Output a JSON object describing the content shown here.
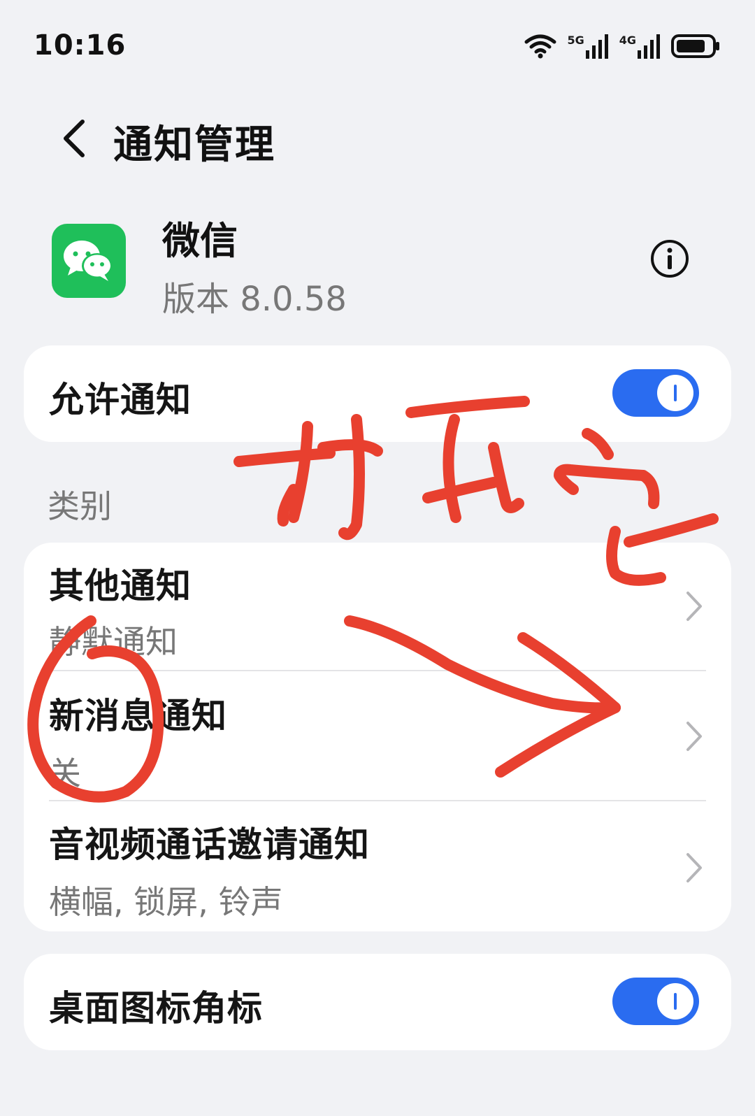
{
  "status_bar": {
    "time": "10:16",
    "network_1": "5G",
    "network_2": "4G"
  },
  "header": {
    "title": "通知管理"
  },
  "app": {
    "name": "微信",
    "version": "版本 8.0.58",
    "icon": "wechat-icon",
    "brand_color": "#1fbf5a"
  },
  "allow_notifications": {
    "label": "允许通知",
    "enabled": true
  },
  "categories": {
    "section_label": "类别",
    "items": [
      {
        "label": "其他通知",
        "sub": "静默通知"
      },
      {
        "label": "新消息通知",
        "sub": "关"
      },
      {
        "label": "音视频通话邀请通知",
        "sub": "横幅, 锁屏, 铃声"
      }
    ]
  },
  "badge": {
    "label": "桌面图标角标",
    "enabled": true
  },
  "colors": {
    "accent": "#2a6cf0",
    "annotation": "#e8402f"
  }
}
